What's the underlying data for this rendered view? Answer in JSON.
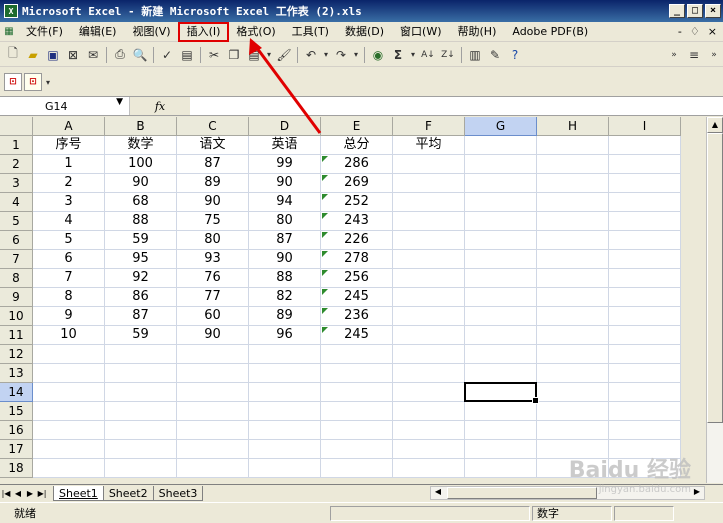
{
  "window": {
    "title": "Microsoft Excel - 新建 Microsoft Excel 工作表 (2).xls",
    "controls": [
      "_",
      "□",
      "×"
    ]
  },
  "menubar": {
    "items": [
      "文件(F)",
      "编辑(E)",
      "视图(V)",
      "插入(I)",
      "格式(O)",
      "工具(T)",
      "数据(D)",
      "窗口(W)",
      "帮助(H)",
      "Adobe PDF(B)"
    ],
    "highlighted_index": 3,
    "doc_controls": [
      "-",
      "♢",
      "×"
    ]
  },
  "formula_bar": {
    "name_box": "G14",
    "fx": "fx",
    "value": ""
  },
  "columns": [
    "A",
    "B",
    "C",
    "D",
    "E",
    "F",
    "G",
    "H",
    "I"
  ],
  "selected_column": "G",
  "rows": [
    [
      "序号",
      "数学",
      "语文",
      "英语",
      "总分",
      "平均",
      "",
      "",
      ""
    ],
    [
      "1",
      "100",
      "87",
      "99",
      "286",
      "",
      "",
      "",
      ""
    ],
    [
      "2",
      "90",
      "89",
      "90",
      "269",
      "",
      "",
      "",
      ""
    ],
    [
      "3",
      "68",
      "90",
      "94",
      "252",
      "",
      "",
      "",
      ""
    ],
    [
      "4",
      "88",
      "75",
      "80",
      "243",
      "",
      "",
      "",
      ""
    ],
    [
      "5",
      "59",
      "80",
      "87",
      "226",
      "",
      "",
      "",
      ""
    ],
    [
      "6",
      "95",
      "93",
      "90",
      "278",
      "",
      "",
      "",
      ""
    ],
    [
      "7",
      "92",
      "76",
      "88",
      "256",
      "",
      "",
      "",
      ""
    ],
    [
      "8",
      "86",
      "77",
      "82",
      "245",
      "",
      "",
      "",
      ""
    ],
    [
      "9",
      "87",
      "60",
      "89",
      "236",
      "",
      "",
      "",
      ""
    ],
    [
      "10",
      "59",
      "90",
      "96",
      "245",
      "",
      "",
      "",
      ""
    ],
    [
      "",
      "",
      "",
      "",
      "",
      "",
      "",
      "",
      ""
    ],
    [
      "",
      "",
      "",
      "",
      "",
      "",
      "",
      "",
      ""
    ],
    [
      "",
      "",
      "",
      "",
      "",
      "",
      "",
      "",
      ""
    ],
    [
      "",
      "",
      "",
      "",
      "",
      "",
      "",
      "",
      ""
    ],
    [
      "",
      "",
      "",
      "",
      "",
      "",
      "",
      "",
      ""
    ],
    [
      "",
      "",
      "",
      "",
      "",
      "",
      "",
      "",
      ""
    ],
    [
      "",
      "",
      "",
      "",
      "",
      "",
      "",
      "",
      ""
    ]
  ],
  "row_numbers": [
    "1",
    "2",
    "3",
    "4",
    "5",
    "6",
    "7",
    "8",
    "9",
    "10",
    "11",
    "12",
    "13",
    "14",
    "15",
    "16",
    "17",
    "18"
  ],
  "selected_row": "14",
  "sheets": [
    "Sheet1",
    "Sheet2",
    "Sheet3"
  ],
  "active_sheet": "Sheet1",
  "status": {
    "ready": "就绪",
    "mode": "数字"
  },
  "watermark": {
    "text": "Baidu 经验",
    "url": "jingyan.baidu.com"
  },
  "colors": {
    "title_bar": "#0a246a",
    "highlight": "#e00000",
    "error_triangle": "#2e8b2e",
    "selected_header": "#c2d3f2"
  },
  "icons": [
    "excel-app-icon",
    "new-icon",
    "open-icon",
    "save-icon",
    "permission-icon",
    "email-icon",
    "print-icon",
    "print-preview-icon",
    "spelling-icon",
    "cut-icon",
    "copy-icon",
    "paste-icon",
    "format-painter-icon",
    "undo-icon",
    "redo-icon",
    "hyperlink-icon",
    "autosum-icon",
    "sort-ascending-icon",
    "chart-wizard-icon",
    "drawing-icon",
    "help-icon",
    "pdf-convert-icon",
    "pdf-email-icon"
  ]
}
